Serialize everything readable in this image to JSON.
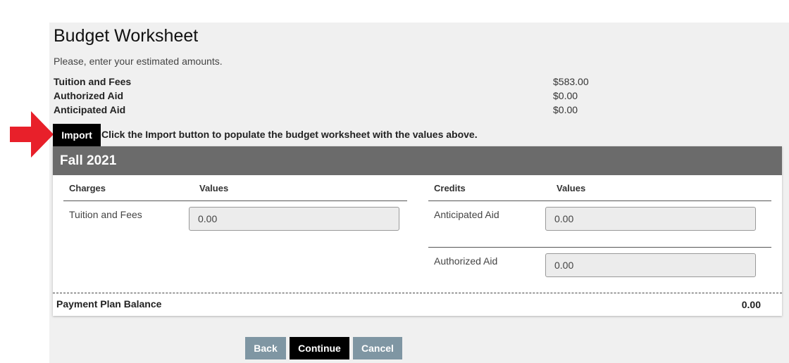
{
  "header": {
    "title": "Budget Worksheet",
    "subtitle": "Please, enter your estimated amounts."
  },
  "summary": [
    {
      "label": "Tuition and Fees",
      "value": "$583.00"
    },
    {
      "label": "Authorized Aid",
      "value": "$0.00"
    },
    {
      "label": "Anticipated Aid",
      "value": "$0.00"
    }
  ],
  "import": {
    "button_label": "Import",
    "hint": "Click the Import button to populate the budget worksheet with the values above.",
    "arrow_color": "#e8202a"
  },
  "term": {
    "name": "Fall 2021",
    "charges": {
      "header": "Charges",
      "values_header": "Values",
      "rows": [
        {
          "label": "Tuition and Fees",
          "value": "0.00"
        }
      ]
    },
    "credits": {
      "header": "Credits",
      "values_header": "Values",
      "rows": [
        {
          "label": "Anticipated Aid",
          "value": "0.00"
        },
        {
          "label": "Authorized Aid",
          "value": "0.00"
        }
      ]
    },
    "balance": {
      "label": "Payment Plan Balance",
      "value": "0.00"
    }
  },
  "actions": {
    "back": "Back",
    "continue": "Continue",
    "cancel": "Cancel"
  }
}
